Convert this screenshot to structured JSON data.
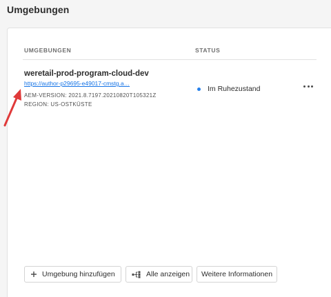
{
  "page": {
    "title": "Umgebungen"
  },
  "table": {
    "columns": {
      "environments": "UMGEBUNGEN",
      "status": "STATUS"
    },
    "rows": [
      {
        "name": "weretail-prod-program-cloud-dev",
        "url": "https://author-p29695-e49017-cmstg.a…",
        "aem_version": "AEM-VERSION: 2021.8.7197.20210820T105321Z",
        "region": "REGION: US-OSTKÜSTE",
        "status": "Im Ruhezustand",
        "status_color": "#2680eb",
        "more_icon": "more-horizontal-icon"
      }
    ]
  },
  "actions": {
    "add_environment": {
      "label": "Umgebung hinzufügen",
      "icon": "plus-icon"
    },
    "show_all": {
      "label": "Alle anzeigen",
      "icon": "list-view-icon"
    },
    "more_info": {
      "label": "Weitere Informationen"
    }
  },
  "annotation": {
    "icon": "red-arrow-icon",
    "color": "#e03a3a"
  }
}
